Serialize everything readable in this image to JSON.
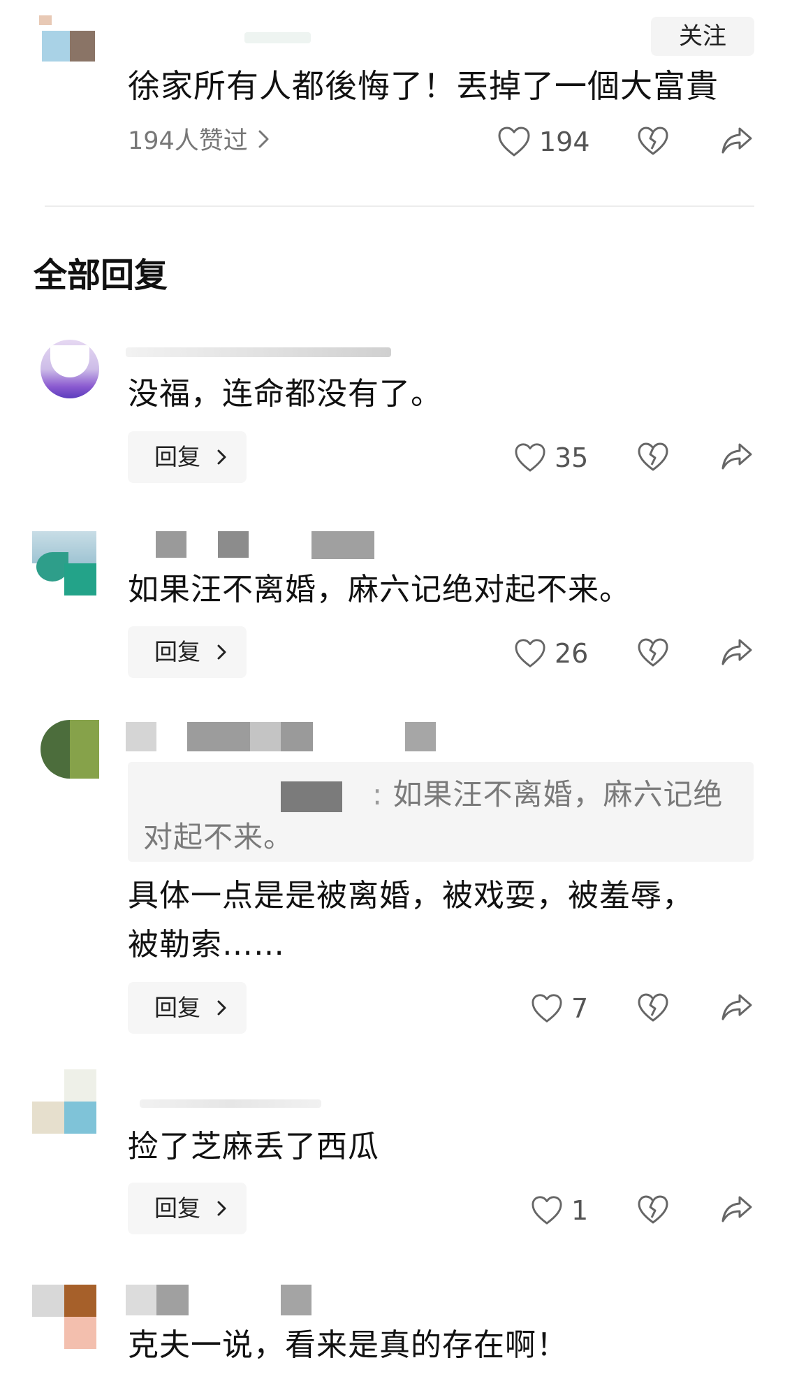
{
  "top_comment": {
    "follow_label": "关注",
    "text": "徐家所有人都後悔了！丟掉了一個大富貴",
    "liked_by": "194人赞过",
    "like_count": "194"
  },
  "section_title": "全部回复",
  "comments": [
    {
      "text": "没福，连命都没有了。",
      "reply_label": "回复",
      "like_count": "35"
    },
    {
      "text": "如果汪不离婚，麻六记绝对起不来。",
      "reply_label": "回复",
      "like_count": "26"
    },
    {
      "quote_line1": "如果汪不离婚，麻六记绝",
      "quote_line2": "对起不来。",
      "text_line1": "具体一点是是被离婚，被戏耍，被羞辱，",
      "text_line2": "被勒索……",
      "reply_label": "回复",
      "like_count": "7"
    },
    {
      "text": "捡了芝麻丢了西瓜",
      "reply_label": "回复",
      "like_count": "1"
    },
    {
      "text": "克夫一说，看来是真的存在啊！"
    }
  ],
  "colors": {
    "accent": "#111111",
    "muted": "#777777",
    "button_bg": "#f6f6f6"
  },
  "icons": [
    "heart-icon",
    "dislike-heart-icon",
    "share-icon",
    "chevron-right-icon"
  ]
}
